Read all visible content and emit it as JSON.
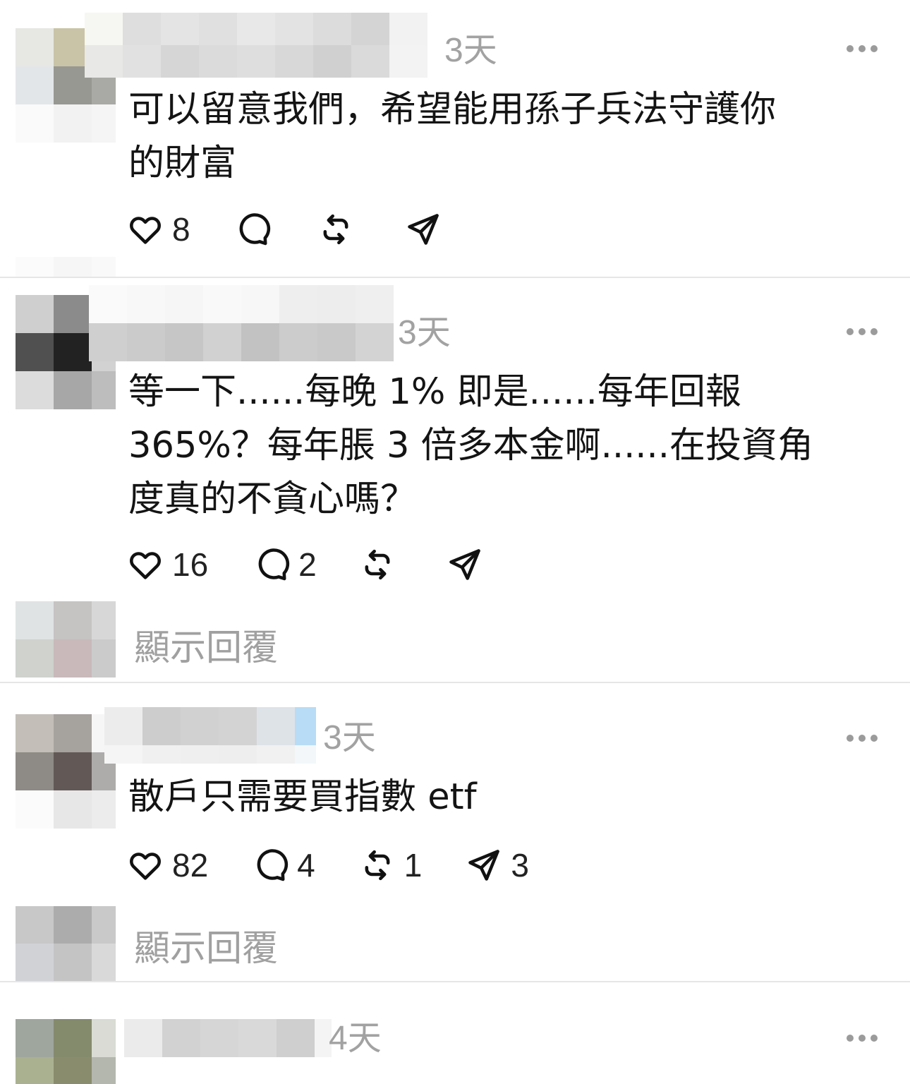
{
  "posts": [
    {
      "time": "3天",
      "lines": [
        "可以留意我們，希望能用孫子兵法守護你",
        "的財富"
      ],
      "likes": "8",
      "comments": "",
      "reposts": "",
      "shares": "",
      "show_replies": ""
    },
    {
      "time": "3天",
      "lines": [
        "等一下......每晚 1% 即是......每年回報",
        " 365%？每年脹 3 倍多本金啊......在投資角",
        "度真的不貪心嗎？"
      ],
      "likes": "16",
      "comments": "2",
      "reposts": "",
      "shares": "",
      "show_replies": "顯示回覆"
    },
    {
      "time": "3天",
      "lines": [
        "散戶只需要買指數 etf"
      ],
      "likes": "82",
      "comments": "4",
      "reposts": "1",
      "shares": "3",
      "show_replies": "顯示回覆"
    },
    {
      "time": "4天",
      "lines": [],
      "likes": "",
      "comments": "",
      "reposts": "",
      "shares": "",
      "show_replies": ""
    }
  ],
  "icons": {
    "like": "heart-icon",
    "comment": "comment-bubble-icon",
    "repost": "repost-icon",
    "share": "share-send-icon",
    "more": "more-options-icon"
  },
  "colors": {
    "text": "#141414",
    "muted": "#a2a2a2",
    "divider": "#e6e6e6"
  }
}
